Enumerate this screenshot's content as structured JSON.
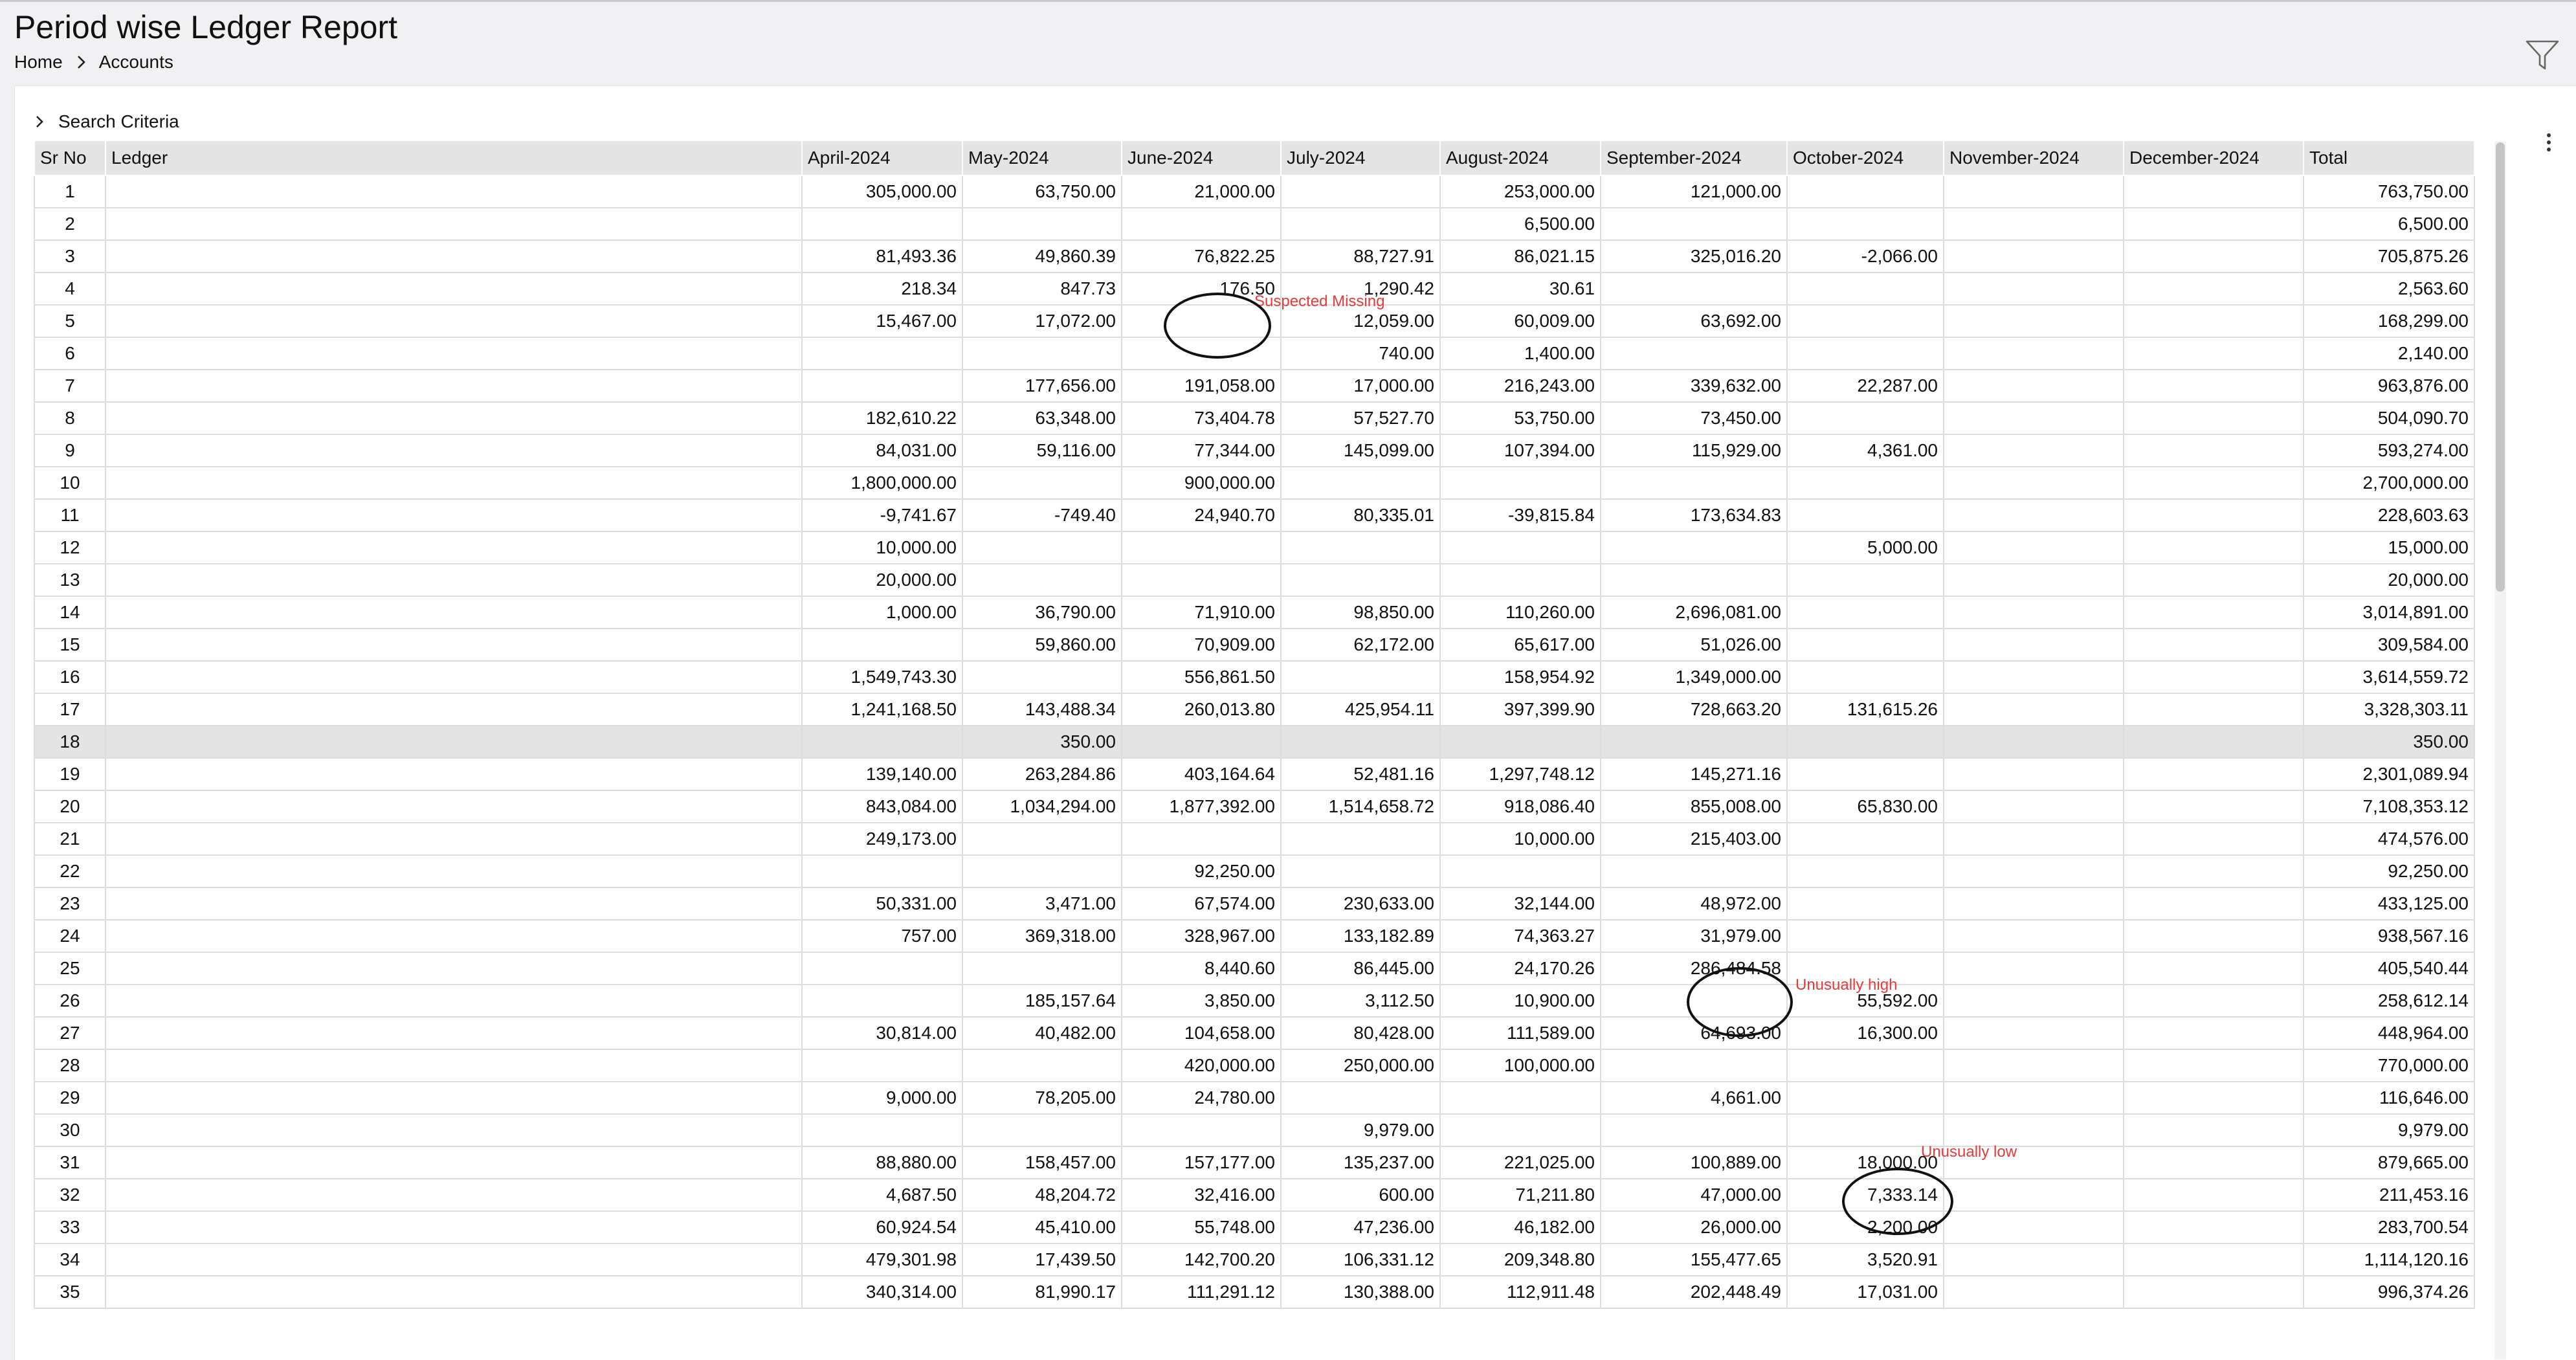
{
  "header": {
    "title": "Period wise Ledger Report",
    "breadcrumb": [
      "Home",
      "Accounts"
    ],
    "filter_icon": "filter-icon"
  },
  "search_criteria_label": "Search Criteria",
  "table": {
    "columns": [
      "Sr No",
      "Ledger",
      "April-2024",
      "May-2024",
      "June-2024",
      "July-2024",
      "August-2024",
      "September-2024",
      "October-2024",
      "November-2024",
      "December-2024",
      "Total"
    ],
    "highlighted_row": 18,
    "rows": [
      {
        "sr": "1",
        "ledger": "",
        "values": [
          "305,000.00",
          "63,750.00",
          "21,000.00",
          "",
          "253,000.00",
          "121,000.00",
          "",
          "",
          "",
          "763,750.00"
        ]
      },
      {
        "sr": "2",
        "ledger": "",
        "values": [
          "",
          "",
          "",
          "",
          "6,500.00",
          "",
          "",
          "",
          "",
          "6,500.00"
        ]
      },
      {
        "sr": "3",
        "ledger": "",
        "values": [
          "81,493.36",
          "49,860.39",
          "76,822.25",
          "88,727.91",
          "86,021.15",
          "325,016.20",
          "-2,066.00",
          "",
          "",
          "705,875.26"
        ]
      },
      {
        "sr": "4",
        "ledger": "",
        "values": [
          "218.34",
          "847.73",
          "176.50",
          "1,290.42",
          "30.61",
          "",
          "",
          "",
          "",
          "2,563.60"
        ]
      },
      {
        "sr": "5",
        "ledger": "",
        "values": [
          "15,467.00",
          "17,072.00",
          "",
          "12,059.00",
          "60,009.00",
          "63,692.00",
          "",
          "",
          "",
          "168,299.00"
        ]
      },
      {
        "sr": "6",
        "ledger": "",
        "values": [
          "",
          "",
          "",
          "740.00",
          "1,400.00",
          "",
          "",
          "",
          "",
          "2,140.00"
        ]
      },
      {
        "sr": "7",
        "ledger": "",
        "values": [
          "",
          "177,656.00",
          "191,058.00",
          "17,000.00",
          "216,243.00",
          "339,632.00",
          "22,287.00",
          "",
          "",
          "963,876.00"
        ]
      },
      {
        "sr": "8",
        "ledger": "",
        "values": [
          "182,610.22",
          "63,348.00",
          "73,404.78",
          "57,527.70",
          "53,750.00",
          "73,450.00",
          "",
          "",
          "",
          "504,090.70"
        ]
      },
      {
        "sr": "9",
        "ledger": "",
        "values": [
          "84,031.00",
          "59,116.00",
          "77,344.00",
          "145,099.00",
          "107,394.00",
          "115,929.00",
          "4,361.00",
          "",
          "",
          "593,274.00"
        ]
      },
      {
        "sr": "10",
        "ledger": "",
        "values": [
          "1,800,000.00",
          "",
          "900,000.00",
          "",
          "",
          "",
          "",
          "",
          "",
          "2,700,000.00"
        ]
      },
      {
        "sr": "11",
        "ledger": "",
        "values": [
          "-9,741.67",
          "-749.40",
          "24,940.70",
          "80,335.01",
          "-39,815.84",
          "173,634.83",
          "",
          "",
          "",
          "228,603.63"
        ]
      },
      {
        "sr": "12",
        "ledger": "",
        "values": [
          "10,000.00",
          "",
          "",
          "",
          "",
          "",
          "5,000.00",
          "",
          "",
          "15,000.00"
        ]
      },
      {
        "sr": "13",
        "ledger": "",
        "values": [
          "20,000.00",
          "",
          "",
          "",
          "",
          "",
          "",
          "",
          "",
          "20,000.00"
        ]
      },
      {
        "sr": "14",
        "ledger": "",
        "values": [
          "1,000.00",
          "36,790.00",
          "71,910.00",
          "98,850.00",
          "110,260.00",
          "2,696,081.00",
          "",
          "",
          "",
          "3,014,891.00"
        ]
      },
      {
        "sr": "15",
        "ledger": "",
        "values": [
          "",
          "59,860.00",
          "70,909.00",
          "62,172.00",
          "65,617.00",
          "51,026.00",
          "",
          "",
          "",
          "309,584.00"
        ]
      },
      {
        "sr": "16",
        "ledger": "",
        "values": [
          "1,549,743.30",
          "",
          "556,861.50",
          "",
          "158,954.92",
          "1,349,000.00",
          "",
          "",
          "",
          "3,614,559.72"
        ]
      },
      {
        "sr": "17",
        "ledger": "",
        "values": [
          "1,241,168.50",
          "143,488.34",
          "260,013.80",
          "425,954.11",
          "397,399.90",
          "728,663.20",
          "131,615.26",
          "",
          "",
          "3,328,303.11"
        ]
      },
      {
        "sr": "18",
        "ledger": "",
        "values": [
          "",
          "350.00",
          "",
          "",
          "",
          "",
          "",
          "",
          "",
          "350.00"
        ]
      },
      {
        "sr": "19",
        "ledger": "",
        "values": [
          "139,140.00",
          "263,284.86",
          "403,164.64",
          "52,481.16",
          "1,297,748.12",
          "145,271.16",
          "",
          "",
          "",
          "2,301,089.94"
        ]
      },
      {
        "sr": "20",
        "ledger": "",
        "values": [
          "843,084.00",
          "1,034,294.00",
          "1,877,392.00",
          "1,514,658.72",
          "918,086.40",
          "855,008.00",
          "65,830.00",
          "",
          "",
          "7,108,353.12"
        ]
      },
      {
        "sr": "21",
        "ledger": "",
        "values": [
          "249,173.00",
          "",
          "",
          "",
          "10,000.00",
          "215,403.00",
          "",
          "",
          "",
          "474,576.00"
        ]
      },
      {
        "sr": "22",
        "ledger": "",
        "values": [
          "",
          "",
          "92,250.00",
          "",
          "",
          "",
          "",
          "",
          "",
          "92,250.00"
        ]
      },
      {
        "sr": "23",
        "ledger": "",
        "values": [
          "50,331.00",
          "3,471.00",
          "67,574.00",
          "230,633.00",
          "32,144.00",
          "48,972.00",
          "",
          "",
          "",
          "433,125.00"
        ]
      },
      {
        "sr": "24",
        "ledger": "",
        "values": [
          "757.00",
          "369,318.00",
          "328,967.00",
          "133,182.89",
          "74,363.27",
          "31,979.00",
          "",
          "",
          "",
          "938,567.16"
        ]
      },
      {
        "sr": "25",
        "ledger": "",
        "values": [
          "",
          "",
          "8,440.60",
          "86,445.00",
          "24,170.26",
          "286,484.58",
          "",
          "",
          "",
          "405,540.44"
        ]
      },
      {
        "sr": "26",
        "ledger": "",
        "values": [
          "",
          "185,157.64",
          "3,850.00",
          "3,112.50",
          "10,900.00",
          "",
          "55,592.00",
          "",
          "",
          "258,612.14"
        ]
      },
      {
        "sr": "27",
        "ledger": "",
        "values": [
          "30,814.00",
          "40,482.00",
          "104,658.00",
          "80,428.00",
          "111,589.00",
          "64,693.00",
          "16,300.00",
          "",
          "",
          "448,964.00"
        ]
      },
      {
        "sr": "28",
        "ledger": "",
        "values": [
          "",
          "",
          "420,000.00",
          "250,000.00",
          "100,000.00",
          "",
          "",
          "",
          "",
          "770,000.00"
        ]
      },
      {
        "sr": "29",
        "ledger": "",
        "values": [
          "9,000.00",
          "78,205.00",
          "24,780.00",
          "",
          "",
          "4,661.00",
          "",
          "",
          "",
          "116,646.00"
        ]
      },
      {
        "sr": "30",
        "ledger": "",
        "values": [
          "",
          "",
          "",
          "9,979.00",
          "",
          "",
          "",
          "",
          "",
          "9,979.00"
        ]
      },
      {
        "sr": "31",
        "ledger": "",
        "values": [
          "88,880.00",
          "158,457.00",
          "157,177.00",
          "135,237.00",
          "221,025.00",
          "100,889.00",
          "18,000.00",
          "",
          "",
          "879,665.00"
        ]
      },
      {
        "sr": "32",
        "ledger": "",
        "values": [
          "4,687.50",
          "48,204.72",
          "32,416.00",
          "600.00",
          "71,211.80",
          "47,000.00",
          "7,333.14",
          "",
          "",
          "211,453.16"
        ]
      },
      {
        "sr": "33",
        "ledger": "",
        "values": [
          "60,924.54",
          "45,410.00",
          "55,748.00",
          "47,236.00",
          "46,182.00",
          "26,000.00",
          "2,200.00",
          "",
          "",
          "283,700.54"
        ]
      },
      {
        "sr": "34",
        "ledger": "",
        "values": [
          "479,301.98",
          "17,439.50",
          "142,700.20",
          "106,331.12",
          "209,348.80",
          "155,477.65",
          "3,520.91",
          "",
          "",
          "1,114,120.16"
        ]
      },
      {
        "sr": "35",
        "ledger": "",
        "values": [
          "340,314.00",
          "81,990.17",
          "111,291.12",
          "130,388.00",
          "112,911.48",
          "202,448.49",
          "17,031.00",
          "",
          "",
          "996,374.26"
        ]
      }
    ]
  },
  "annotations": [
    {
      "label": "Suspected Missing",
      "row": 5,
      "column": "June-2024"
    },
    {
      "label": "Unusually high",
      "row": 25,
      "column": "September-2024"
    },
    {
      "label": "Unusually low",
      "row": 31,
      "column": "October-2024"
    }
  ]
}
